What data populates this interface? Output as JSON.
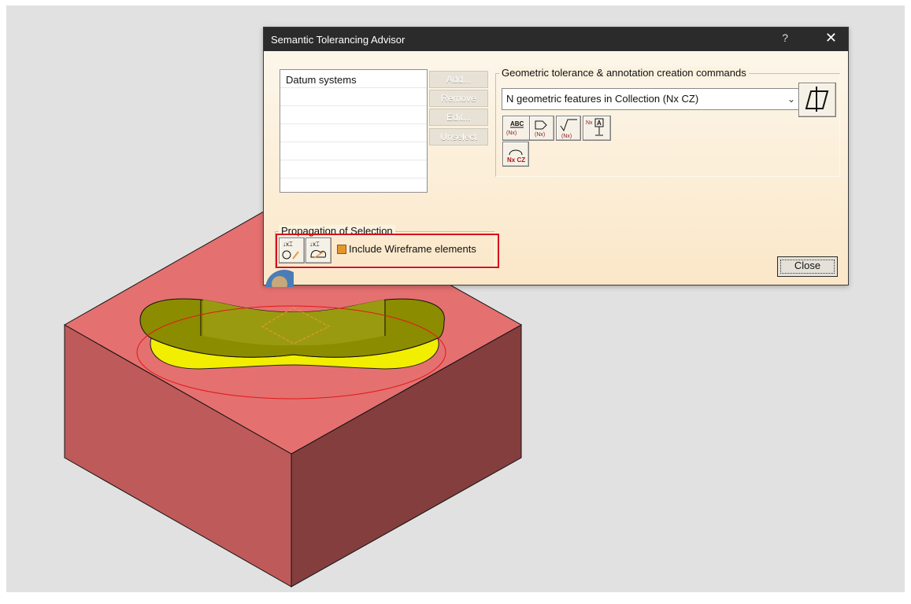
{
  "dialog": {
    "title": "Semantic Tolerancing Advisor",
    "help": "?",
    "close_glyph": "✕",
    "datum_list_header": "Datum systems",
    "buttons": {
      "add": "Add...",
      "remove": "Remove",
      "edit": "Edit...",
      "unselect": "Unselect",
      "close": "Close"
    },
    "geometric_group_title": "Geometric tolerance & annotation creation commands",
    "combo_value": "N geometric features in Collection (Nx CZ)",
    "propagation_group_title": "Propagation of Selection",
    "include_wireframe_label": "Include Wireframe elements",
    "icons": {
      "datum_nx_top": "ABC",
      "datum_nx_bottom": "(Nx)",
      "profile_nx": "(Nx)",
      "rough_nx": "(Nx)",
      "nx_label": "Nx",
      "nx_datum_letter": "A",
      "nxcz": "Nx CZ",
      "prop_label": "↓x⌶"
    }
  },
  "colors": {
    "viewport_bg": "#e1e1e1",
    "part_top": "#e26b6b",
    "part_left": "#bf5a5a",
    "part_right": "#843e3e",
    "slot_floor": "#f2ee00",
    "slot_wall": "#8c8c00",
    "highlight_red": "#d4101e",
    "titlebar": "#2b2b2b"
  }
}
